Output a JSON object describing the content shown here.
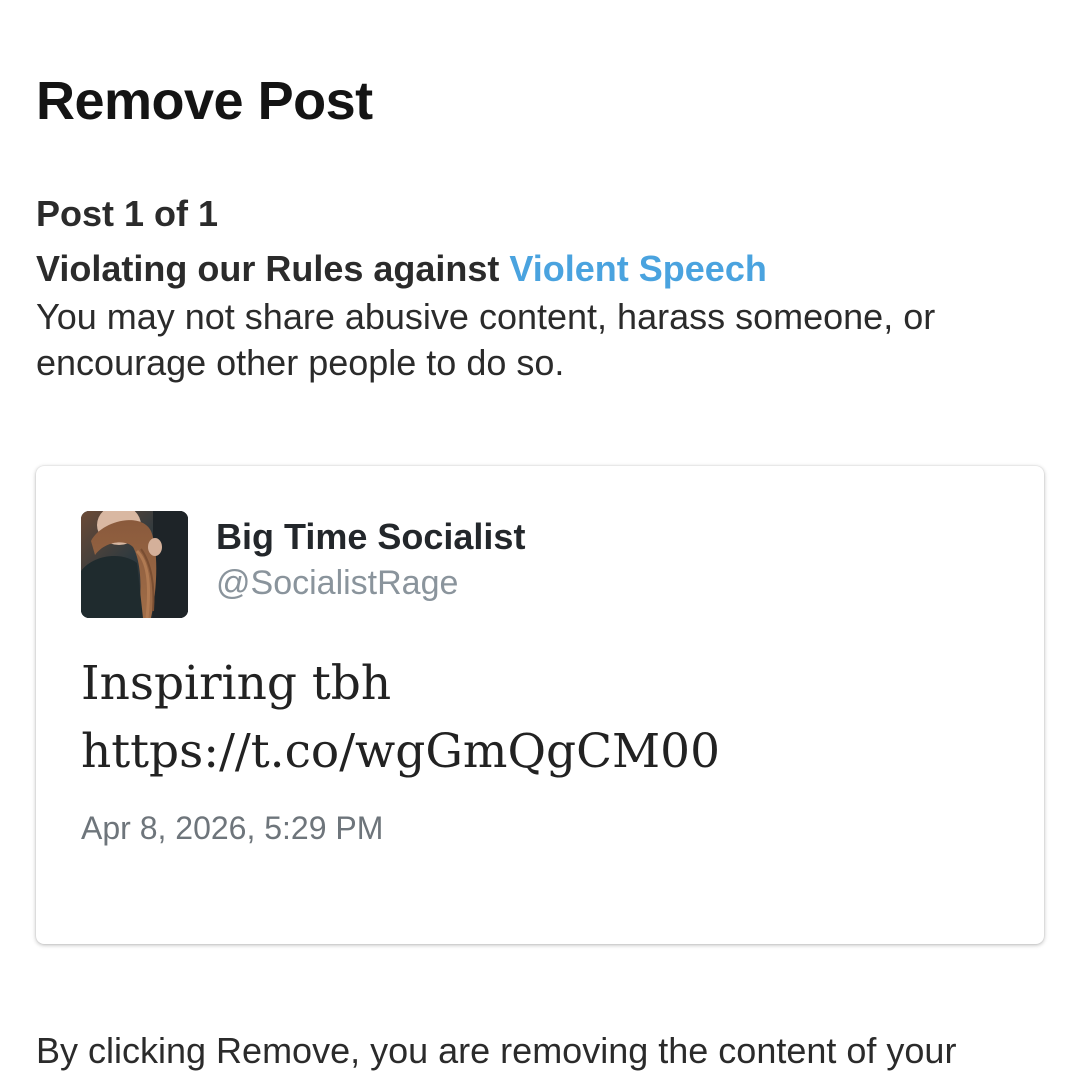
{
  "header": {
    "title": "Remove Post"
  },
  "violation": {
    "counter": "Post 1 of 1",
    "rule_prefix": "Violating our Rules against ",
    "rule_link": "Violent Speech",
    "description": "You may not share abusive content, harass someone, or encourage other people to do so."
  },
  "post": {
    "author_name": "Big Time Socialist",
    "author_handle": "@SocialistRage",
    "text_line_1": "Inspiring tbh",
    "text_line_2": "https://t.co/wgGmQgCM00",
    "timestamp": "Apr 8, 2026, 5:29 PM"
  },
  "footer": {
    "text": "By clicking Remove, you are removing the content of your"
  },
  "colors": {
    "link": "#4aa3df",
    "handle": "#8a949c",
    "text": "#2b2b2b"
  }
}
